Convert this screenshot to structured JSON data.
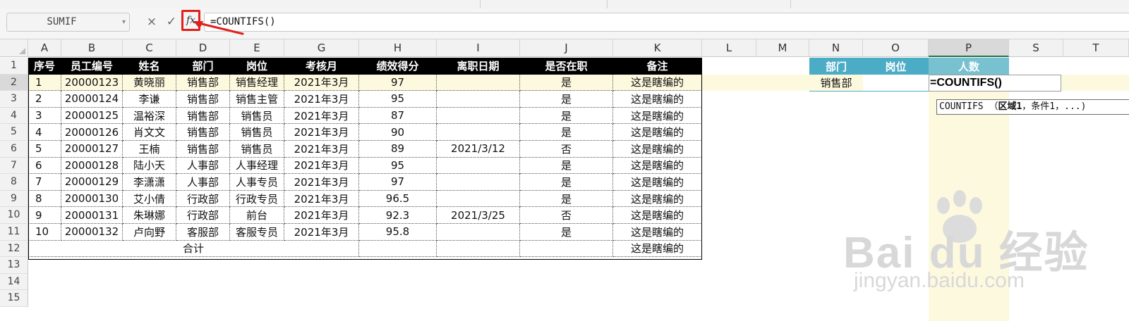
{
  "formula_bar": {
    "name_box": "SUMIF",
    "cancel_icon": "×",
    "confirm_icon": "✓",
    "fx_label": "fx",
    "formula": "=COUNTIFS()"
  },
  "columns": [
    "A",
    "B",
    "C",
    "D",
    "E",
    "G",
    "H",
    "I",
    "J",
    "K",
    "L",
    "M",
    "N",
    "O",
    "P",
    "S",
    "T"
  ],
  "rows": [
    "1",
    "2",
    "3",
    "4",
    "5",
    "6",
    "7",
    "8",
    "9",
    "10",
    "11",
    "12",
    "13",
    "14",
    "15"
  ],
  "table": {
    "headers": [
      "序号",
      "员工编号",
      "姓名",
      "部门",
      "岗位",
      "考核月",
      "绩效得分",
      "离职日期",
      "是否在职",
      "备注"
    ],
    "rows": [
      [
        "1",
        "20000123",
        "黄晓丽",
        "销售部",
        "销售经理",
        "2021年3月",
        "97",
        "",
        "是",
        "这是瞎编的"
      ],
      [
        "2",
        "20000124",
        "李谦",
        "销售部",
        "销售主管",
        "2021年3月",
        "95",
        "",
        "是",
        "这是瞎编的"
      ],
      [
        "3",
        "20000125",
        "温裕深",
        "销售部",
        "销售员",
        "2021年3月",
        "87",
        "",
        "是",
        "这是瞎编的"
      ],
      [
        "4",
        "20000126",
        "肖文文",
        "销售部",
        "销售员",
        "2021年3月",
        "90",
        "",
        "是",
        "这是瞎编的"
      ],
      [
        "5",
        "20000127",
        "王楠",
        "销售部",
        "销售员",
        "2021年3月",
        "89",
        "2021/3/12",
        "否",
        "这是瞎编的"
      ],
      [
        "6",
        "20000128",
        "陆小天",
        "人事部",
        "人事经理",
        "2021年3月",
        "95",
        "",
        "是",
        "这是瞎编的"
      ],
      [
        "7",
        "20000129",
        "李潇潇",
        "人事部",
        "人事专员",
        "2021年3月",
        "97",
        "",
        "是",
        "这是瞎编的"
      ],
      [
        "8",
        "20000130",
        "艾小倩",
        "行政部",
        "行政专员",
        "2021年3月",
        "96.5",
        "",
        "是",
        "这是瞎编的"
      ],
      [
        "9",
        "20000131",
        "朱琳娜",
        "行政部",
        "前台",
        "2021年3月",
        "92.3",
        "2021/3/25",
        "否",
        "这是瞎编的"
      ],
      [
        "10",
        "20000132",
        "卢向野",
        "客服部",
        "客服专员",
        "2021年3月",
        "95.8",
        "",
        "是",
        "这是瞎编的"
      ]
    ],
    "total_label": "合计",
    "total_note": "这是瞎编的"
  },
  "mini_table": {
    "headers": [
      "部门",
      "岗位",
      "人数"
    ],
    "dept_value": "销售部",
    "edit_value": "=COUNTIFS()"
  },
  "tooltip": {
    "func": "COUNTIFS",
    "open": "（",
    "arg1": "区域1",
    "rest": "，条件1，...)"
  },
  "watermark": {
    "brand": "Bai du 经验",
    "url": "jingyan.baidu.com"
  },
  "colors": {
    "header_black": "#000000",
    "mini_header": "#4bacc6",
    "row_highlight": "#fdf9de",
    "fx_highlight": "#e0201c"
  }
}
